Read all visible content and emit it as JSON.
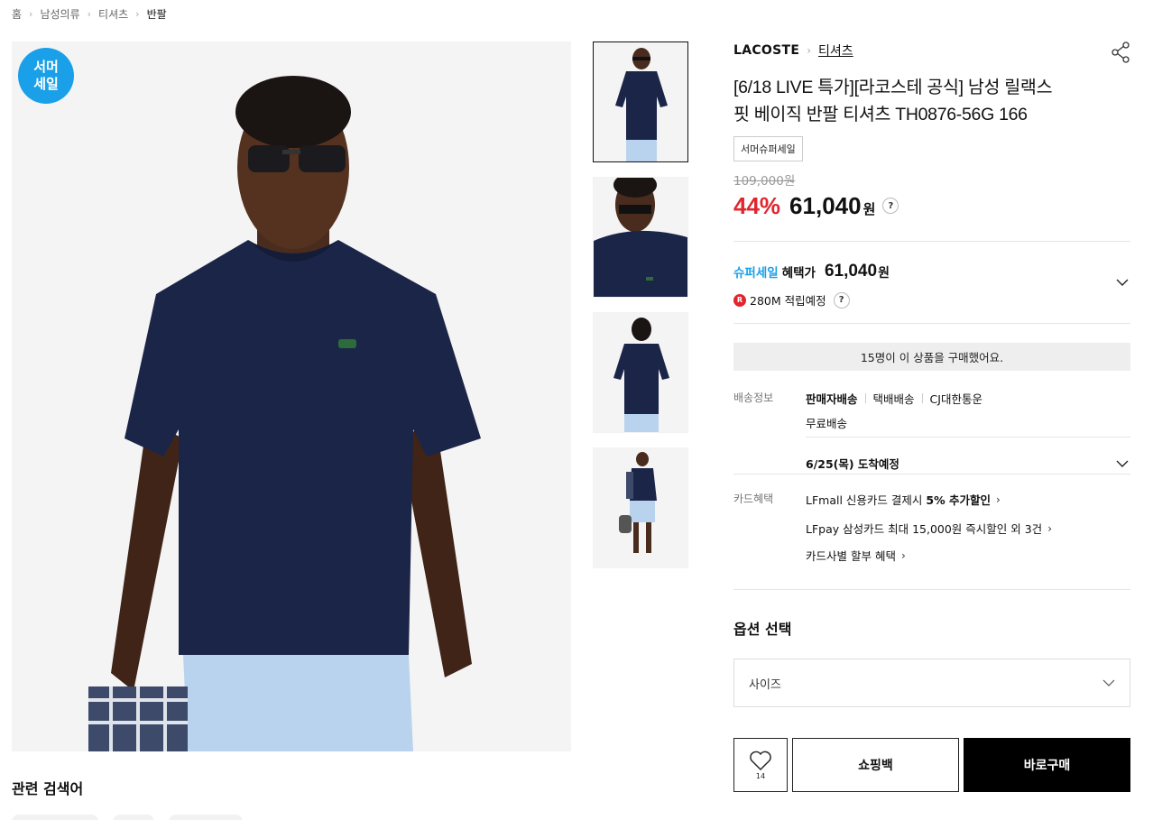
{
  "breadcrumb": [
    "홈",
    "남성의류",
    "티셔츠",
    "반팔"
  ],
  "badge": {
    "line1": "서머",
    "line2": "세일"
  },
  "product": {
    "brand": "LACOSTE",
    "category": "티셔츠",
    "title_line1": "[6/18 LIVE 특가][라코스테 공식] 남성 릴랙스",
    "title_line2": "핏 베이직 반팔 티셔츠 TH0876-56G 166",
    "tag": "서머슈퍼세일",
    "original_price": "109,000원",
    "discount": "44%",
    "price": "61,040",
    "price_unit": "원",
    "help": "?"
  },
  "benefit": {
    "label_blue": "슈퍼세일",
    "label": "혜택가",
    "price": "61,040",
    "unit": "원",
    "point_badge": "R",
    "points": "280M 적립예정"
  },
  "buyers_text": "15명이 이 상품을 구매했어요.",
  "shipping": {
    "label": "배송정보",
    "type": "판매자배송",
    "method": "택배배송",
    "carrier": "CJ대한통운",
    "fee": "무료배송",
    "arrival": "6/25(목) 도착예정"
  },
  "card": {
    "label": "카드혜택",
    "items": [
      {
        "text": "LFmall 신용카드 결제시",
        "bold": "5% 추가할인"
      },
      {
        "text": "LFpay 삼성카드 최대 15,000원 즉시할인 외 3건",
        "bold": ""
      },
      {
        "text": "카드사별 할부 혜택",
        "bold": ""
      }
    ]
  },
  "options": {
    "title": "옵션 선택",
    "size_placeholder": "사이즈"
  },
  "actions": {
    "wish_count": "14",
    "bag": "쇼핑백",
    "buy": "바로구매"
  },
  "related_title": "관련 검색어",
  "colors": {
    "accent_blue": "#1aa0e8",
    "sale_red": "#e0262f",
    "shirt_navy": "#1b2548",
    "shorts_blue": "#b9d3ee"
  }
}
